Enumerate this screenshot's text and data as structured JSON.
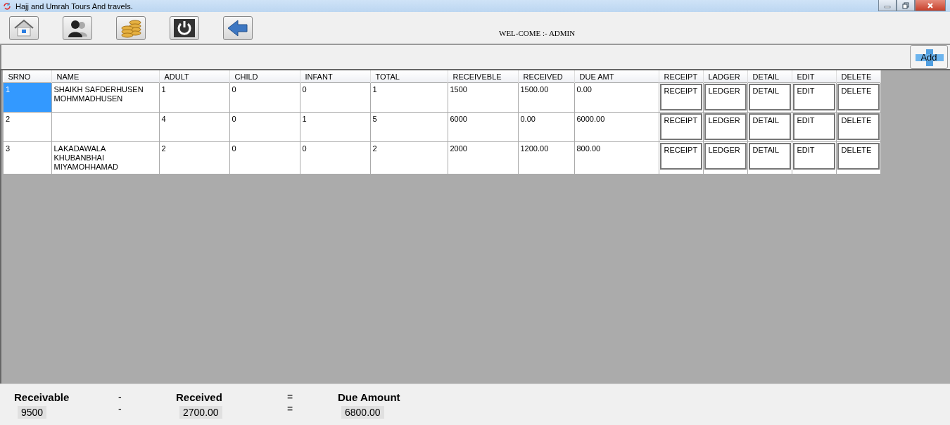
{
  "window": {
    "title": "Hajj and Umrah Tours And travels."
  },
  "toolbar": {
    "welcome": "WEL-COME :- ADMIN"
  },
  "add_button": {
    "label": "Add"
  },
  "table": {
    "columns": [
      "SRNO",
      "NAME",
      "ADULT",
      "CHILD",
      "INFANT",
      "TOTAL",
      "RECEIVEBLE",
      "RECEIVED",
      "DUE AMT",
      "RECEIPT",
      "LADGER",
      "DETAIL",
      "EDIT",
      "DELETE"
    ],
    "rows": [
      {
        "selected": true,
        "cells": [
          "1",
          "SHAIKH SAFDERHUSEN MOHMMADHUSEN",
          "1",
          "0",
          "0",
          "1",
          "1500",
          "1500.00",
          "0.00"
        ],
        "actions": [
          "RECEIPT",
          "LEDGER",
          "DETAIL",
          "EDIT",
          "DELETE"
        ]
      },
      {
        "selected": false,
        "cells": [
          "2",
          "",
          "4",
          "0",
          "1",
          "5",
          "6000",
          "0.00",
          "6000.00"
        ],
        "actions": [
          "RECEIPT",
          "LEDGER",
          "DETAIL",
          "EDIT",
          "DELETE"
        ]
      },
      {
        "selected": false,
        "cells": [
          "3",
          "LAKADAWALA KHUBANBHAI MIYAMOHHAMAD",
          "2",
          "0",
          "0",
          "2",
          "2000",
          "1200.00",
          "800.00"
        ],
        "actions": [
          "RECEIPT",
          "LEDGER",
          "DETAIL",
          "EDIT",
          "DELETE"
        ]
      }
    ]
  },
  "summary": {
    "labels": [
      "Receivable",
      "-",
      "Received",
      "=",
      "Due Amount"
    ],
    "values": [
      "9500",
      "-",
      "2700.00",
      "=",
      "6800.00"
    ]
  }
}
